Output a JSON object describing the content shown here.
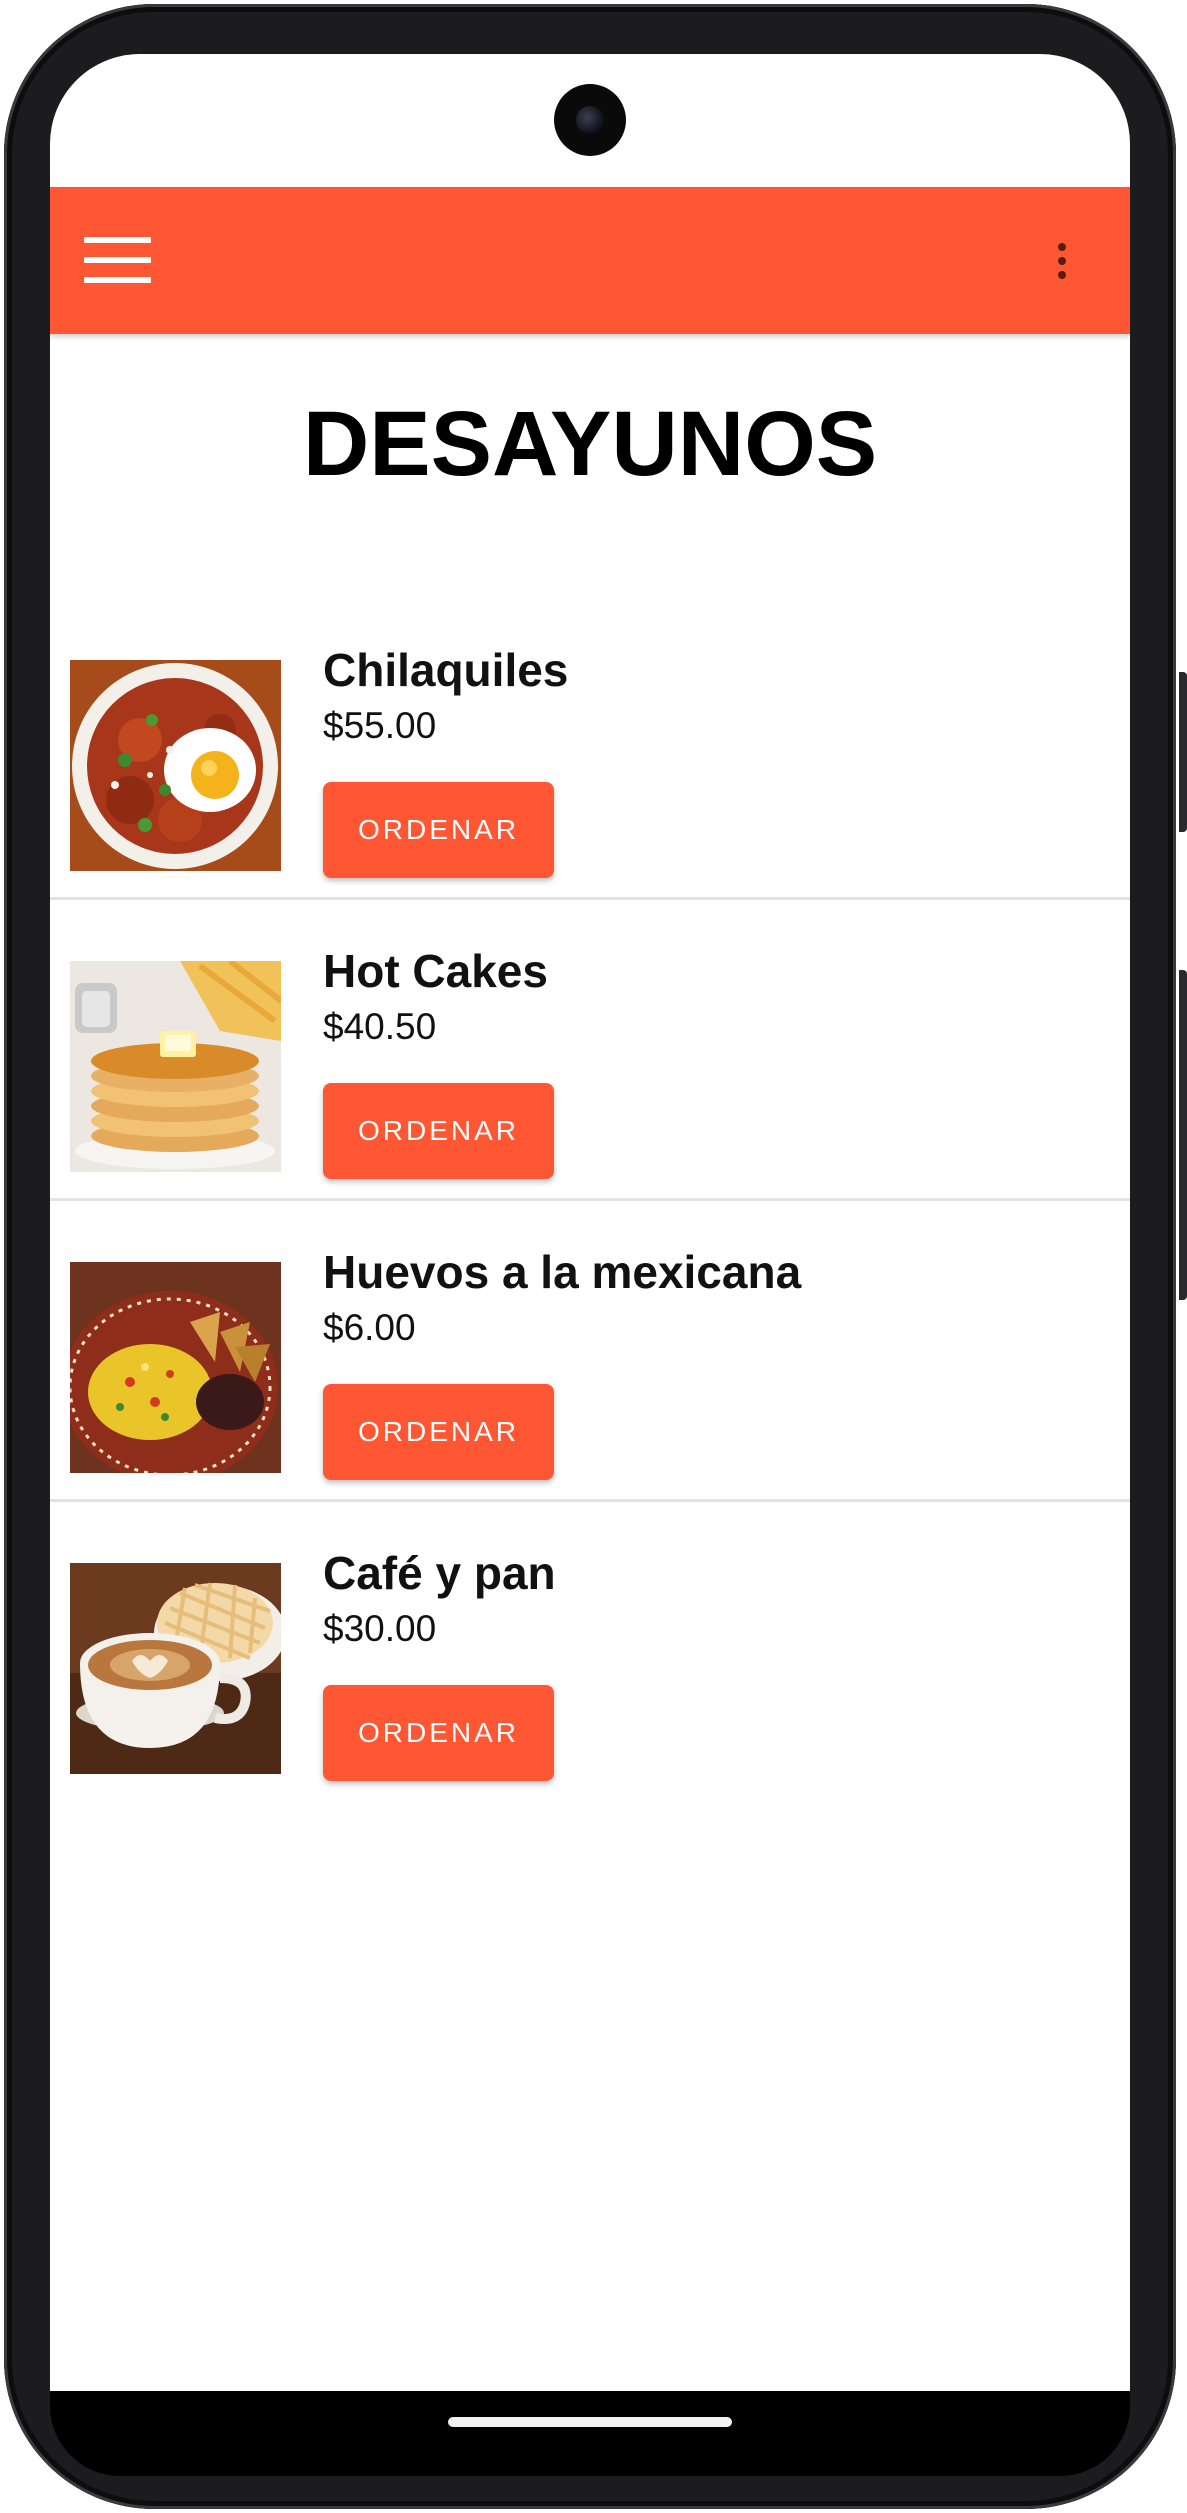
{
  "app": {
    "accent_color": "#ff5733",
    "menu_icon": "hamburger-menu-icon",
    "more_icon": "more-vert-icon"
  },
  "page": {
    "title": "DESAYUNOS"
  },
  "menu_items": [
    {
      "name": "Chilaquiles",
      "price": "$55.00",
      "button_label": "ORDENAR",
      "image": "chilaquiles-photo"
    },
    {
      "name": "Hot Cakes",
      "price": "$40.50",
      "button_label": "ORDENAR",
      "image": "hot-cakes-photo"
    },
    {
      "name": "Huevos a la mexicana",
      "price": "$6.00",
      "button_label": "ORDENAR",
      "image": "huevos-a-la-mexicana-photo"
    },
    {
      "name": "Café y pan",
      "price": "$30.00",
      "button_label": "ORDENAR",
      "image": "cafe-y-pan-photo"
    }
  ]
}
